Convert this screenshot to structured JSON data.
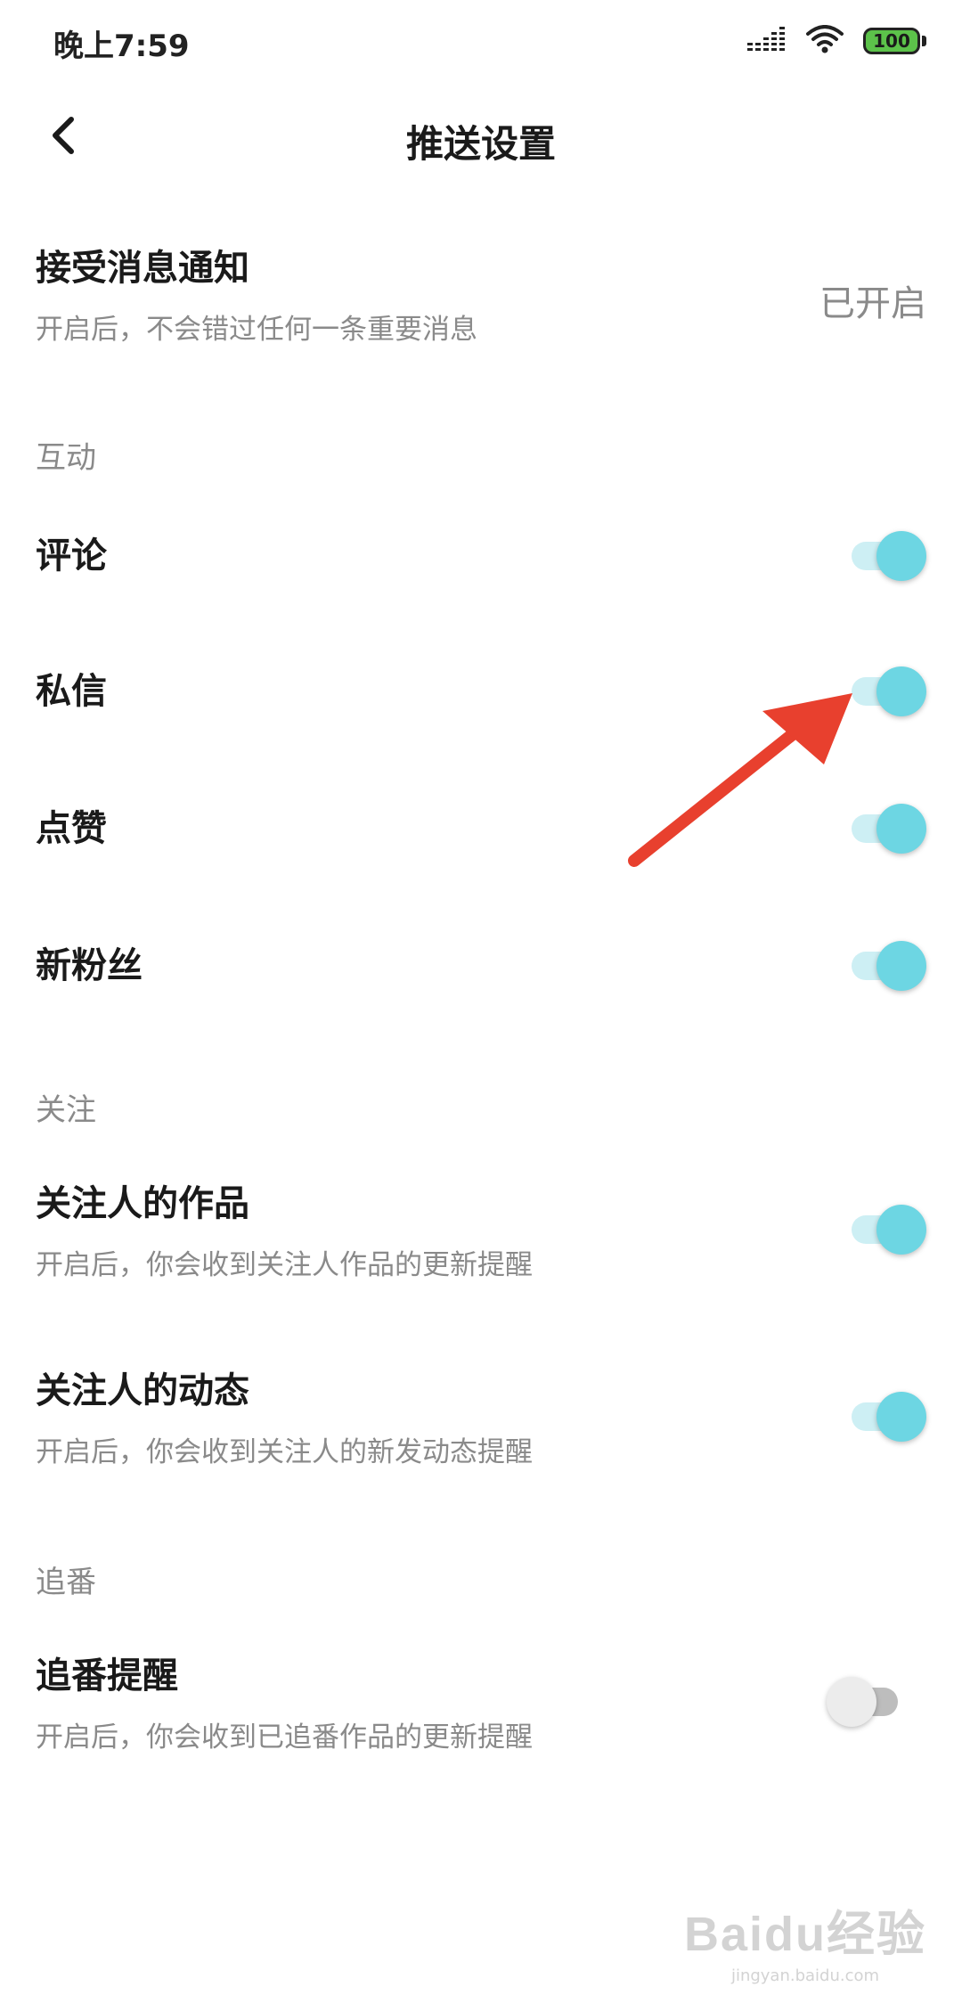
{
  "status_bar": {
    "time": "晚上7:59",
    "battery_level": "100",
    "icons": [
      "signal-icon",
      "wifi-icon",
      "battery-icon"
    ]
  },
  "nav": {
    "title": "推送设置",
    "back_icon": "back-arrow-icon"
  },
  "notify": {
    "title": "接受消息通知",
    "subtitle": "开启后，不会错过任何一条重要消息",
    "status": "已开启"
  },
  "sections": {
    "interaction": {
      "header": "互动",
      "items": [
        {
          "label": "评论",
          "on": true
        },
        {
          "label": "私信",
          "on": true
        },
        {
          "label": "点赞",
          "on": true
        },
        {
          "label": "新粉丝",
          "on": true
        }
      ]
    },
    "follow": {
      "header": "关注",
      "items": [
        {
          "label": "关注人的作品",
          "subtitle": "开启后，你会收到关注人作品的更新提醒",
          "on": true
        },
        {
          "label": "关注人的动态",
          "subtitle": "开启后，你会收到关注人的新发动态提醒",
          "on": true
        }
      ]
    },
    "bangumi": {
      "header": "追番",
      "items": [
        {
          "label": "追番提醒",
          "subtitle": "开启后，你会收到已追番作品的更新提醒",
          "on": false
        }
      ]
    }
  },
  "colors": {
    "switch_on_thumb": "#6dd6e3",
    "switch_on_track": "#cdeff4",
    "switch_off_thumb": "#ececec",
    "switch_off_track": "#bdbdbd",
    "annotation_arrow": "#e8402e"
  },
  "watermark": {
    "logo": "Baidu经验",
    "url": "jingyan.baidu.com"
  }
}
